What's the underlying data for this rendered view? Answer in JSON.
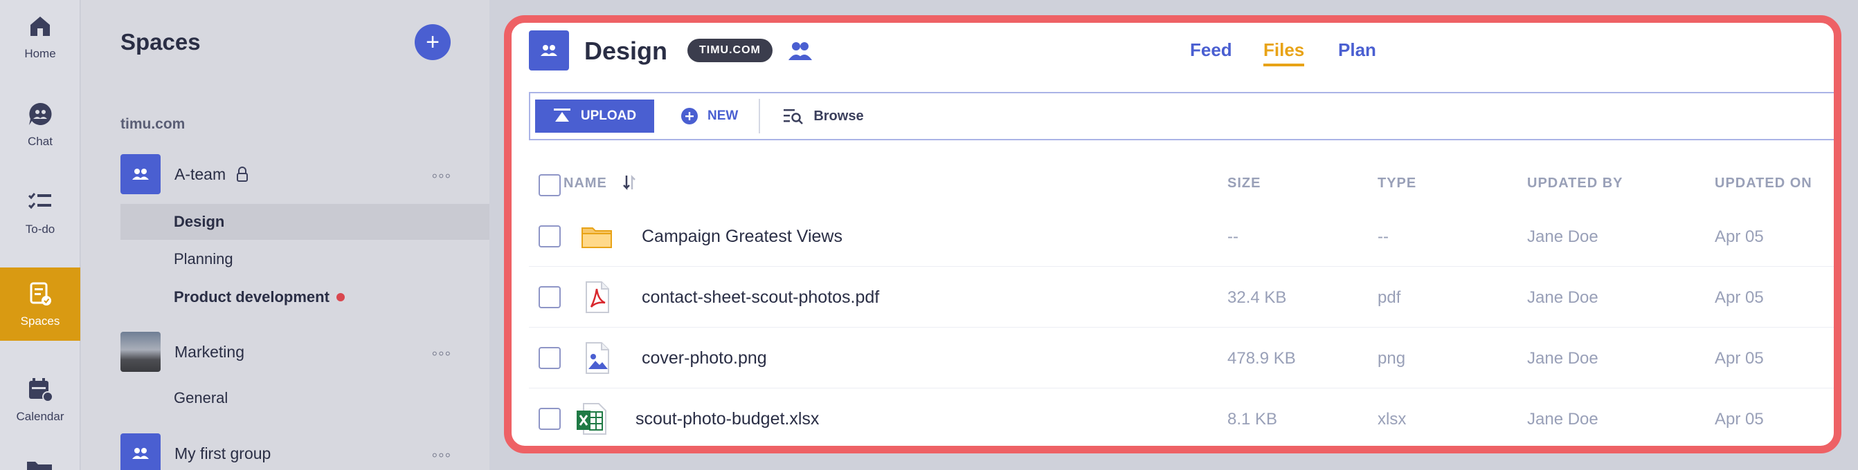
{
  "rail": {
    "items": [
      {
        "label": "Home",
        "icon": "home-icon"
      },
      {
        "label": "Chat",
        "icon": "chat-icon"
      },
      {
        "label": "To-do",
        "icon": "todo-icon"
      },
      {
        "label": "Spaces",
        "icon": "spaces-icon",
        "active": true
      },
      {
        "label": "Calendar",
        "icon": "calendar-icon"
      }
    ]
  },
  "spaces": {
    "title": "Spaces",
    "add_label": "+",
    "org_label": "timu.com",
    "groups": [
      {
        "name": "A-team",
        "more": "◦◦◦",
        "channels": [
          {
            "name": "Design",
            "selected": true
          },
          {
            "name": "Planning"
          },
          {
            "name": "Product development",
            "unread": true
          }
        ]
      },
      {
        "name": "Marketing",
        "more": "◦◦◦",
        "channels": [
          {
            "name": "General"
          }
        ]
      },
      {
        "name": "My first group",
        "more": "◦◦◦"
      }
    ]
  },
  "header": {
    "title": "Design",
    "org_badge": "TIMU.COM",
    "tabs": [
      "Feed",
      "Files",
      "Plan"
    ],
    "active_tab": "Files"
  },
  "toolbar": {
    "upload_label": "UPLOAD",
    "new_label": "NEW",
    "browse_label": "Browse"
  },
  "table": {
    "columns": [
      "NAME",
      "SIZE",
      "TYPE",
      "UPDATED BY",
      "UPDATED ON"
    ],
    "rows": [
      {
        "name": "Campaign Greatest Views",
        "size": "--",
        "type": "--",
        "updated_by": "Jane Doe",
        "updated_on": "Apr 05",
        "icon": "folder-icon"
      },
      {
        "name": "contact-sheet-scout-photos.pdf",
        "size": "32.4 KB",
        "type": "pdf",
        "updated_by": "Jane Doe",
        "updated_on": "Apr 05",
        "icon": "pdf-file-icon"
      },
      {
        "name": "cover-photo.png",
        "size": "478.9 KB",
        "type": "png",
        "updated_by": "Jane Doe",
        "updated_on": "Apr 05",
        "icon": "image-file-icon"
      },
      {
        "name": "scout-photo-budget.xlsx",
        "size": "8.1 KB",
        "type": "xlsx",
        "updated_by": "Jane Doe",
        "updated_on": "Apr 05",
        "icon": "excel-file-icon"
      }
    ]
  },
  "colors": {
    "accent": "#4a5fd1",
    "active_tab": "#e8a317",
    "highlight_border": "#ee6165",
    "spaces_active": "#d99a12",
    "unread": "#d9474f"
  }
}
